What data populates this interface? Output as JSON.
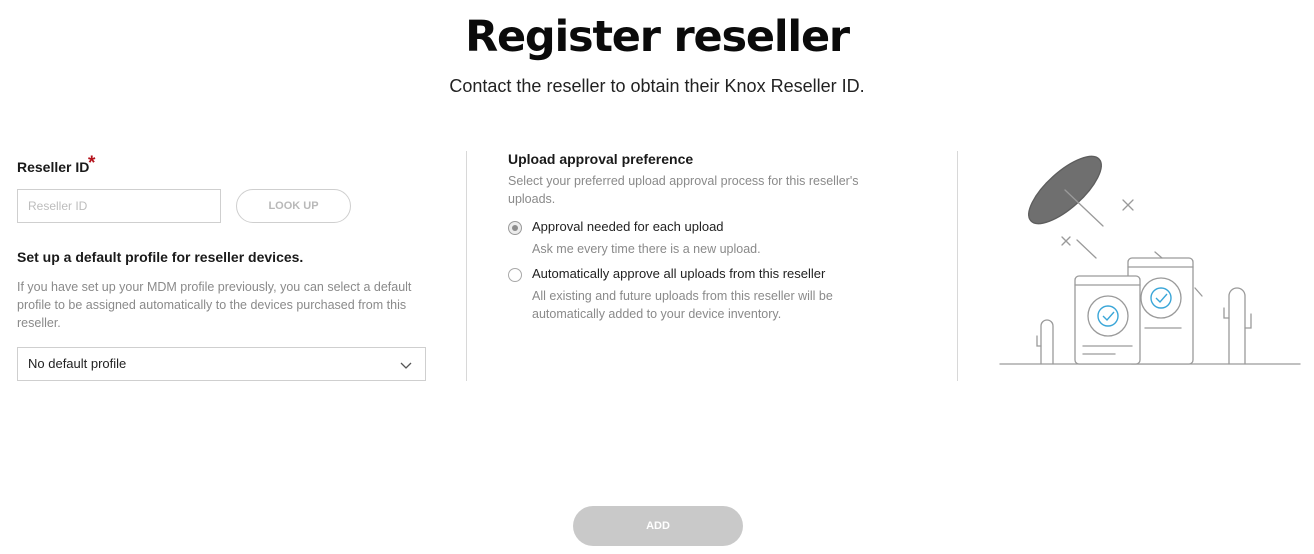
{
  "header": {
    "title": "Register reseller",
    "subtitle": "Contact the reseller to obtain their Knox Reseller ID."
  },
  "reseller_id": {
    "label": "Reseller ID",
    "required_mark": "*",
    "placeholder": "Reseller ID",
    "value": "",
    "lookup_label": "LOOK UP"
  },
  "default_profile": {
    "heading": "Set up a default profile for reseller devices.",
    "help_line1": "If you have set up your MDM profile previously, you can select a default",
    "help_line2": "profile to be assigned automatically to the devices purchased from this",
    "help_line3": "reseller.",
    "selected": "No default profile"
  },
  "upload_pref": {
    "heading": "Upload approval preference",
    "help_line1": "Select your preferred upload approval process for this reseller's",
    "help_line2": "uploads.",
    "options": [
      {
        "label": "Approval needed for each upload",
        "desc_line1": "Ask me every time there is a new upload.",
        "desc_line2": "",
        "checked": true
      },
      {
        "label": "Automatically approve all uploads from this reseller",
        "desc_line1": "All existing and future uploads from this reseller will be",
        "desc_line2": "automatically added to your device inventory.",
        "checked": false
      }
    ]
  },
  "footer": {
    "add_label": "ADD"
  },
  "colors": {
    "required": "#b4121b",
    "disabled_button": "#c9c9c9",
    "illustration_stroke": "#9a9a9a",
    "check_accent": "#3aa6d8"
  },
  "icons": [
    "chevron-down-icon",
    "devices-illustration"
  ]
}
